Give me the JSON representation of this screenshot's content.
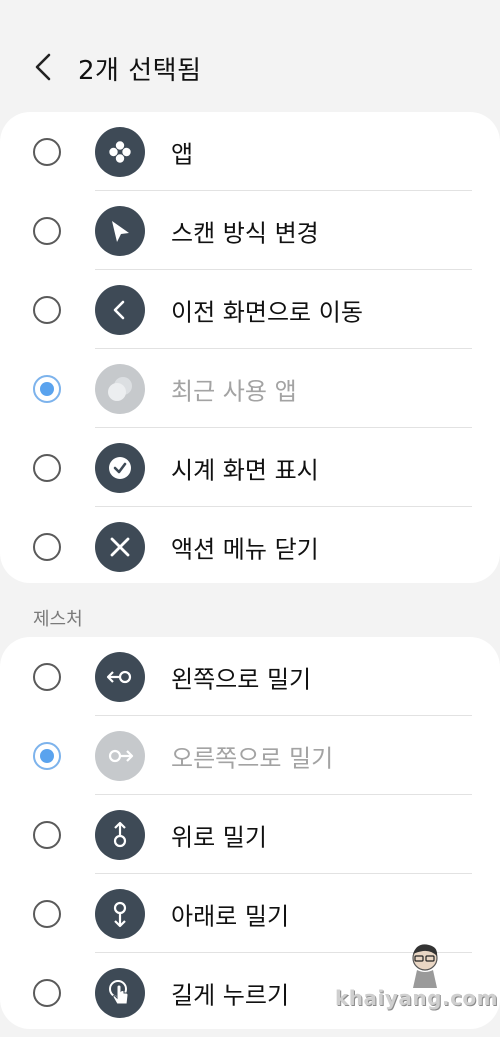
{
  "header": {
    "title": "2개 선택됨"
  },
  "section_gestures": {
    "title": "제스처"
  },
  "actions_list": [
    {
      "label": "앱",
      "icon": "apps-icon",
      "selected": false,
      "disabled": false
    },
    {
      "label": "스캔 방식 변경",
      "icon": "cursor-icon",
      "selected": false,
      "disabled": false
    },
    {
      "label": "이전 화면으로 이동",
      "icon": "back-icon",
      "selected": false,
      "disabled": false
    },
    {
      "label": "최근 사용 앱",
      "icon": "recent-apps-icon",
      "selected": true,
      "disabled": true
    },
    {
      "label": "시계 화면 표시",
      "icon": "clock-icon",
      "selected": false,
      "disabled": false
    },
    {
      "label": "액션 메뉴 닫기",
      "icon": "close-icon",
      "selected": false,
      "disabled": false
    }
  ],
  "gestures_list": [
    {
      "label": "왼쪽으로 밀기",
      "icon": "swipe-left-icon",
      "selected": false,
      "disabled": false
    },
    {
      "label": "오른쪽으로 밀기",
      "icon": "swipe-right-icon",
      "selected": true,
      "disabled": true
    },
    {
      "label": "위로 밀기",
      "icon": "swipe-up-icon",
      "selected": false,
      "disabled": false
    },
    {
      "label": "아래로 밀기",
      "icon": "swipe-down-icon",
      "selected": false,
      "disabled": false
    },
    {
      "label": "길게 누르기",
      "icon": "long-press-icon",
      "selected": false,
      "disabled": false
    }
  ],
  "watermark": {
    "text": "khaiyang.com"
  },
  "colors": {
    "background": "#f3f3f3",
    "card": "#ffffff",
    "icon_bg": "#3e4a56",
    "icon_bg_disabled": "#c6c9cc",
    "radio_selected": "#5aa3ee"
  }
}
